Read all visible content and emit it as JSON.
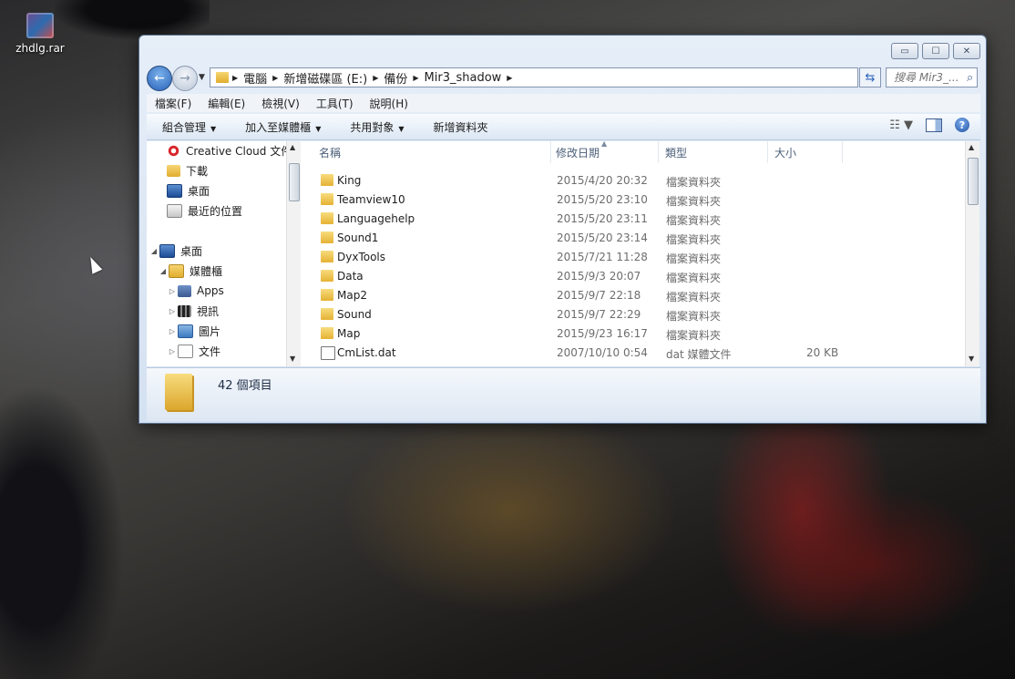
{
  "desktop": {
    "icon_label": "zhdlg.rar"
  },
  "window": {
    "controls": [
      "▭",
      "☐",
      "✕"
    ],
    "breadcrumb": [
      "電腦",
      "新增磁碟區 (E:)",
      "備份",
      "Mir3_shadow"
    ],
    "search_placeholder": "搜尋 Mir3_...",
    "menu": [
      "檔案(F)",
      "編輯(E)",
      "檢視(V)",
      "工具(T)",
      "說明(H)"
    ],
    "commands": [
      "組合管理",
      "加入至媒體櫃",
      "共用對象",
      "新增資料夾"
    ],
    "nav_items": [
      {
        "label": "Creative Cloud 文件",
        "icon": "creative-cloud-icon"
      },
      {
        "label": "下載",
        "icon": "downloads-folder-icon"
      },
      {
        "label": "桌面",
        "icon": "desktop-icon"
      },
      {
        "label": "最近的位置",
        "icon": "recent-places-icon"
      },
      {
        "label": "桌面",
        "icon": "desktop-icon"
      },
      {
        "label": "媒體櫃",
        "icon": "library-icon"
      },
      {
        "label": "Apps",
        "icon": "apps-icon"
      },
      {
        "label": "視訊",
        "icon": "video-icon"
      },
      {
        "label": "圖片",
        "icon": "pictures-icon"
      },
      {
        "label": "文件",
        "icon": "documents-icon"
      }
    ],
    "columns": [
      "名稱",
      "修改日期",
      "類型",
      "大小"
    ],
    "files": [
      {
        "name": "King",
        "date": "2015/4/20 20:32",
        "type": "檔案資料夾",
        "size": "",
        "icon": "folder-icon"
      },
      {
        "name": "Teamview10",
        "date": "2015/5/20 23:10",
        "type": "檔案資料夾",
        "size": "",
        "icon": "folder-icon"
      },
      {
        "name": "Languagehelp",
        "date": "2015/5/20 23:11",
        "type": "檔案資料夾",
        "size": "",
        "icon": "folder-icon"
      },
      {
        "name": "Sound1",
        "date": "2015/5/20 23:14",
        "type": "檔案資料夾",
        "size": "",
        "icon": "folder-icon"
      },
      {
        "name": "DyxTools",
        "date": "2015/7/21 11:28",
        "type": "檔案資料夾",
        "size": "",
        "icon": "folder-icon"
      },
      {
        "name": "Data",
        "date": "2015/9/3 20:07",
        "type": "檔案資料夾",
        "size": "",
        "icon": "folder-icon"
      },
      {
        "name": "Map2",
        "date": "2015/9/7 22:18",
        "type": "檔案資料夾",
        "size": "",
        "icon": "folder-icon"
      },
      {
        "name": "Sound",
        "date": "2015/9/7 22:29",
        "type": "檔案資料夾",
        "size": "",
        "icon": "folder-icon"
      },
      {
        "name": "Map",
        "date": "2015/9/23 16:17",
        "type": "檔案資料夾",
        "size": "",
        "icon": "folder-icon"
      },
      {
        "name": "CmList.dat",
        "date": "2007/10/10 0:54",
        "type": "dat 媒體文件",
        "size": "20 KB",
        "icon": "dat-file-icon"
      }
    ],
    "status_count": "42 個項目"
  }
}
